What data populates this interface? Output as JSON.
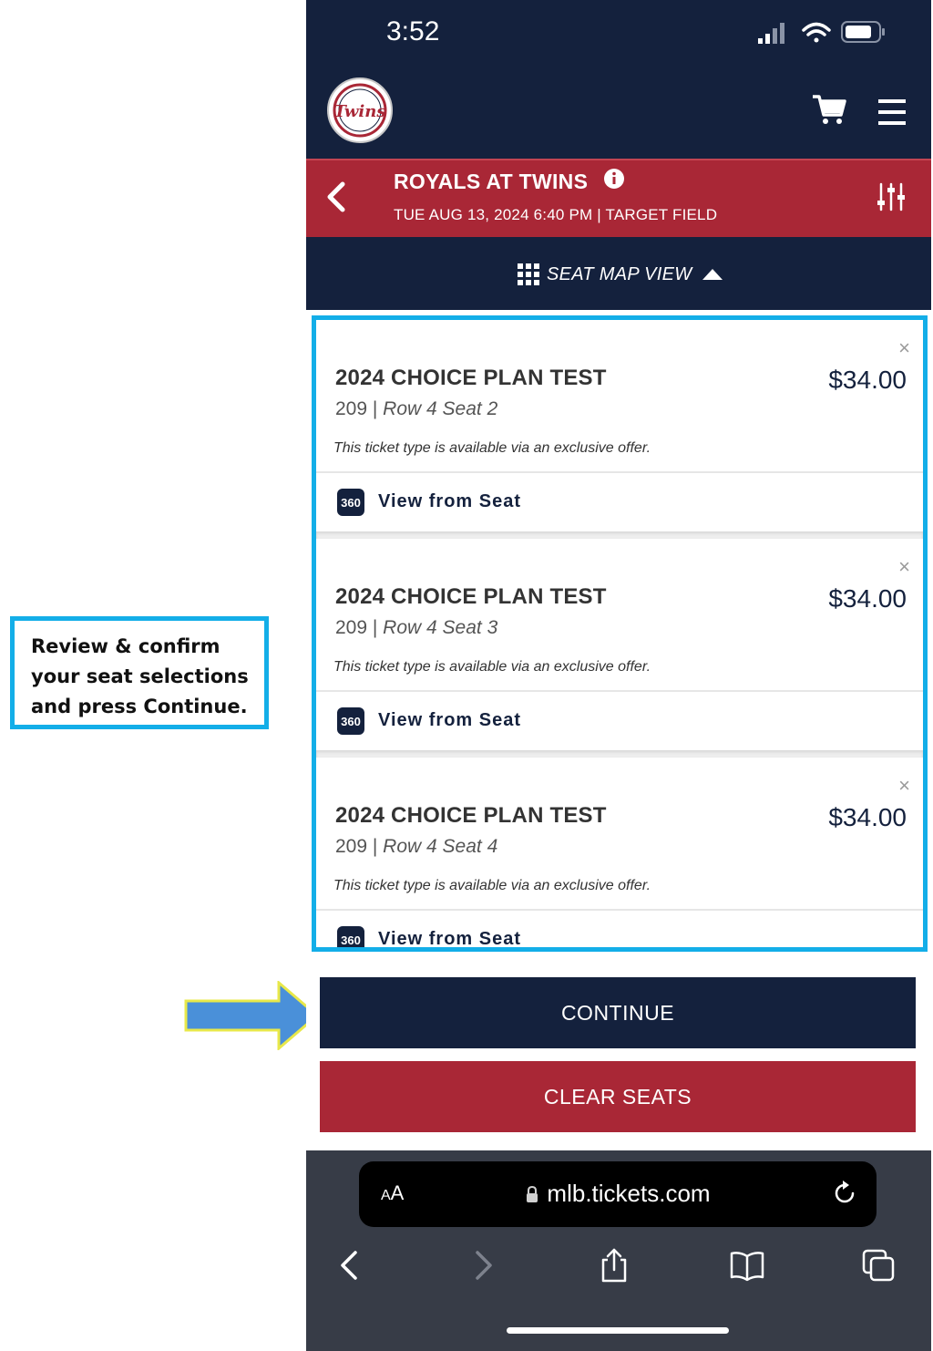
{
  "annotation": {
    "callout_text": "Review & confirm\nyour seat selections\nand press Continue."
  },
  "status_bar": {
    "time": "3:52"
  },
  "header": {
    "logo_text": "Twins"
  },
  "event": {
    "title": "ROYALS AT TWINS",
    "subtitle": "TUE AUG 13, 2024 6:40 PM | TARGET FIELD"
  },
  "map_toggle": {
    "label": "SEAT MAP VIEW"
  },
  "tickets": [
    {
      "name": "2024 CHOICE PLAN TEST",
      "price": "$34.00",
      "section": "209",
      "seat_detail": "Row 4 Seat 2",
      "note": "This ticket type is available via an exclusive offer.",
      "view_label": "View from Seat",
      "remove_symbol": "×"
    },
    {
      "name": "2024 CHOICE PLAN TEST",
      "price": "$34.00",
      "section": "209",
      "seat_detail": "Row 4 Seat 3",
      "note": "This ticket type is available via an exclusive offer.",
      "view_label": "View from Seat",
      "remove_symbol": "×"
    },
    {
      "name": "2024 CHOICE PLAN TEST",
      "price": "$34.00",
      "section": "209",
      "seat_detail": "Row 4 Seat 4",
      "note": "This ticket type is available via an exclusive offer.",
      "view_label": "View from Seat",
      "remove_symbol": "×"
    }
  ],
  "actions": {
    "continue_label": "CONTINUE",
    "clear_label": "CLEAR SEATS"
  },
  "browser": {
    "text_size_big": "A",
    "text_size_small": "A",
    "url": "mlb.tickets.com"
  },
  "colors": {
    "navy": "#14213d",
    "red": "#a92736",
    "highlight": "#13aee8",
    "arrow": "#4a90d9"
  },
  "icons": [
    "signal-icon",
    "wifi-icon",
    "battery-icon",
    "cart-icon",
    "menu-icon",
    "back-icon",
    "info-icon",
    "filter-icon",
    "grid-icon",
    "caret-up-icon",
    "close-icon",
    "360-icon",
    "lock-icon",
    "reload-icon",
    "back-arrow-icon",
    "forward-arrow-icon",
    "share-icon",
    "bookmarks-icon",
    "tabs-icon"
  ]
}
